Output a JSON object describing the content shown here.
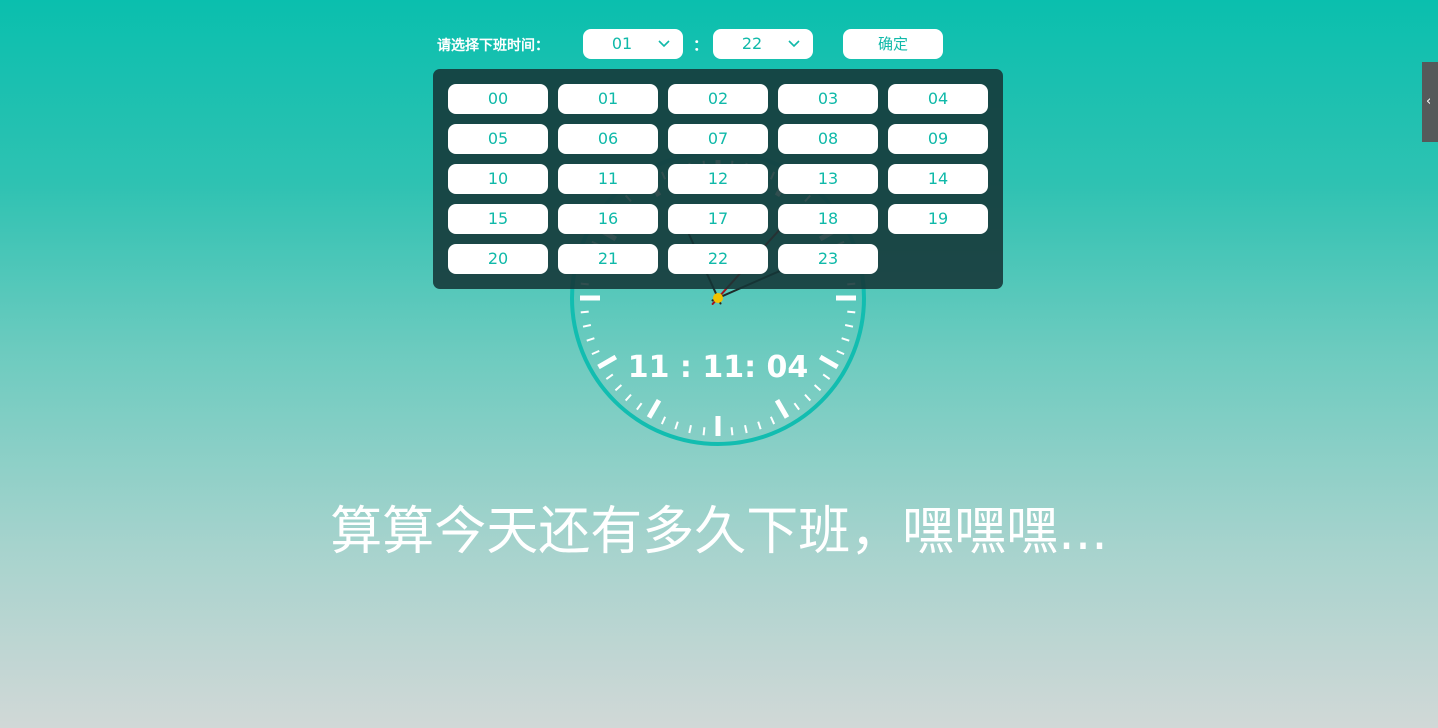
{
  "header": {
    "prompt_label": "请选择下班时间：",
    "hour_value": "01",
    "colon": "：",
    "minute_value": "22",
    "confirm_label": "确定"
  },
  "hour_dropdown": {
    "options": [
      "00",
      "01",
      "02",
      "03",
      "04",
      "05",
      "06",
      "07",
      "08",
      "09",
      "10",
      "11",
      "12",
      "13",
      "14",
      "15",
      "16",
      "17",
      "18",
      "19",
      "20",
      "21",
      "22",
      "23"
    ]
  },
  "clock": {
    "digital_time": "11 : 11: 04",
    "hours": 11,
    "minutes": 11,
    "seconds": 4,
    "ring_color": "#12bdb0",
    "second_hand_color": "#a0141e",
    "center_dot_color": "#f2c200"
  },
  "slogan": "算算今天还有多久下班，嘿嘿嘿...",
  "side_tab": {
    "arrow": "‹"
  },
  "colors": {
    "accent": "#10b9a9"
  }
}
